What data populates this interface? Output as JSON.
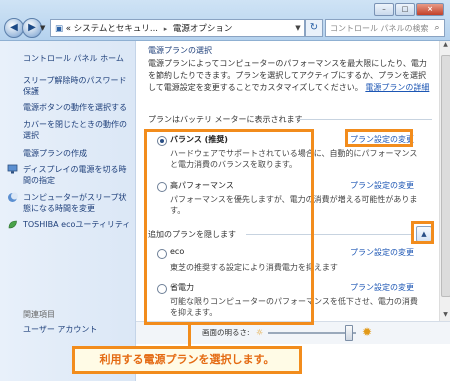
{
  "window": {
    "minimize_label": "–",
    "maximize_label": "□",
    "close_label": "×"
  },
  "address": {
    "prefix": "«",
    "crumb1": "システムとセキュリ...",
    "crumb2": "電源オプション",
    "search_placeholder": "コントロール パネルの検索"
  },
  "sidebar": {
    "home": "コントロール パネル ホーム",
    "items": [
      "スリープ解除時のパスワード保護",
      "電源ボタンの動作を選択する",
      "カバーを閉じたときの動作の選択",
      "電源プランの作成",
      "ディスプレイの電源を切る時間の指定",
      "コンピューターがスリープ状態になる時間を変更",
      "TOSHIBA ecoユーティリティ"
    ],
    "related_heading": "関連項目",
    "related_items": [
      "ユーザー アカウント"
    ]
  },
  "main": {
    "title": "電源プランの選択",
    "description": "電源プランによってコンピューターのパフォーマンスを最大限にしたり、電力を節約したりできます。プランを選択してアクティブにするか、プランを選択して電源設定を変更することでカスタマイズしてください。",
    "description_link": "電源プランの詳細",
    "battery_section": "プランはバッテリ メーターに表示されます",
    "hidden_section": "追加のプランを隠します",
    "change_link": "プラン設定の変更",
    "plans": [
      {
        "name": "バランス (推奨)",
        "desc": "ハードウェアでサポートされている場合に、自動的にパフォーマンスと電力消費のバランスを取ります。",
        "selected": true
      },
      {
        "name": "高パフォーマンス",
        "desc": "パフォーマンスを優先しますが、電力の消費が増える可能性があります。",
        "selected": false
      },
      {
        "name": "eco",
        "desc": "東芝の推奨する設定により消費電力を抑えます",
        "selected": false
      },
      {
        "name": "省電力",
        "desc": "可能な限りコンピューターのパフォーマンスを低下させ、電力の消費を抑えます。",
        "selected": false
      }
    ]
  },
  "brightness": {
    "label": "画面の明るさ:",
    "level_fraction": 0.92
  },
  "caption": "利用する電源プランを選択します。",
  "colors": {
    "highlight": "#f28c1c",
    "link": "#1c56b4",
    "nav_text": "#1e3f7a"
  }
}
